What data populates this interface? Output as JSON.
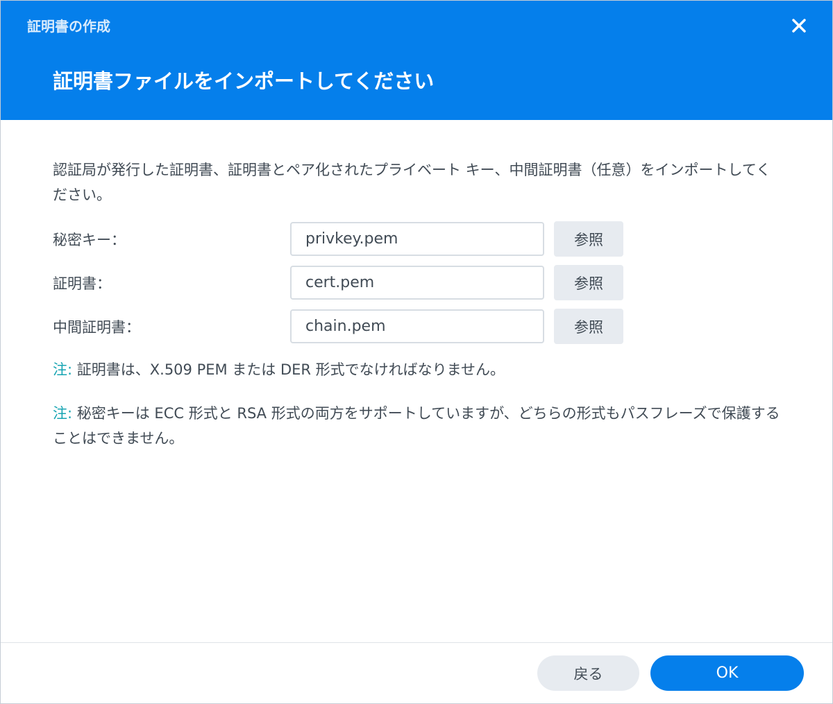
{
  "window": {
    "title": "証明書の作成",
    "close_icon": "close-icon"
  },
  "header": {
    "title": "証明書ファイルをインポートしてください"
  },
  "description": "認証局が発行した証明書、証明書とペア化されたプライベート キー、中間証明書（任意）をインポートしてください。",
  "fields": [
    {
      "label": "秘密キー：",
      "value": "privkey.pem",
      "browse_label": "参照"
    },
    {
      "label": "証明書：",
      "value": "cert.pem",
      "browse_label": "参照"
    },
    {
      "label": "中間証明書：",
      "value": "chain.pem",
      "browse_label": "参照"
    }
  ],
  "notes": [
    {
      "prefix": "注:",
      "text": " 証明書は、X.509 PEM または DER 形式でなければなりません。"
    },
    {
      "prefix": "注:",
      "text": " 秘密キーは ECC 形式と RSA 形式の両方をサポートしていますが、どちらの形式もパスフレーズで保護することはできません。"
    }
  ],
  "footer": {
    "back_label": "戻る",
    "ok_label": "OK"
  },
  "colors": {
    "accent": "#057feb",
    "note_prefix": "#16a4b2",
    "button_secondary": "#e7ebf0",
    "text": "#414b55"
  }
}
